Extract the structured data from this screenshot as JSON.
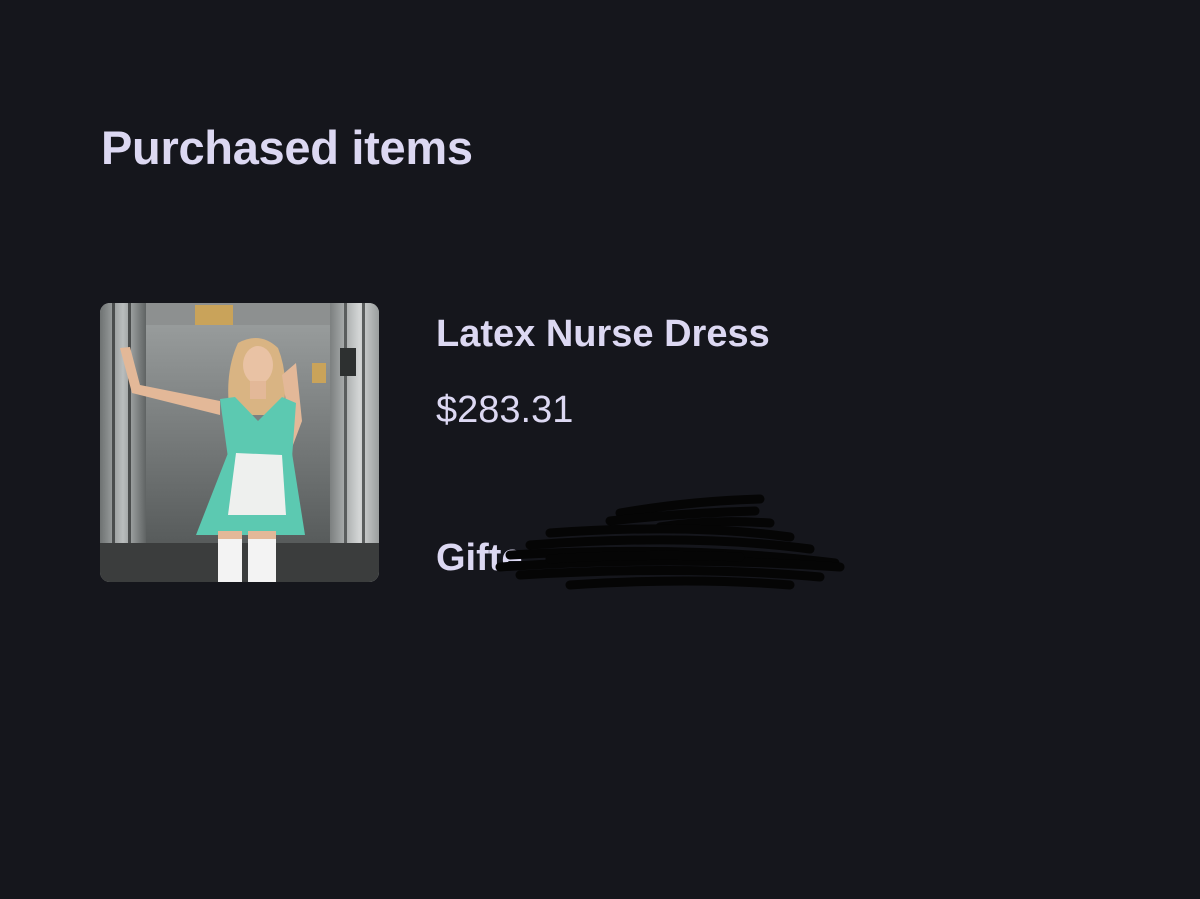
{
  "page": {
    "title": "Purchased items",
    "background": "#15161c",
    "text_color": "#dcd8f2"
  },
  "item": {
    "name": "Latex Nurse Dress",
    "price": "$283.31",
    "gift_label": "Gifte"
  },
  "colors": {
    "dress": "#5cc9b1",
    "apron": "#eef0ee",
    "redaction": "#050505"
  }
}
